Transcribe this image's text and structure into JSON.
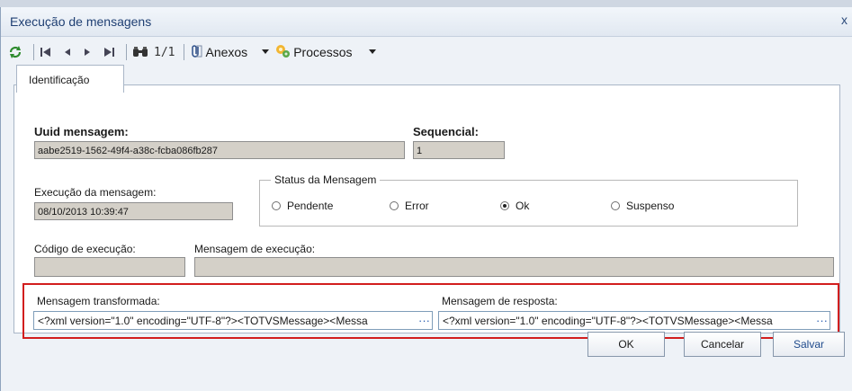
{
  "window": {
    "title": "Execução de mensagens",
    "close_glyph": "x"
  },
  "toolbar": {
    "pager": "1/1",
    "attachments_label": "Anexos",
    "processes_label": "Processos"
  },
  "tabs": [
    {
      "label": "Identificação"
    }
  ],
  "form": {
    "uuid_label": "Uuid mensagem:",
    "uuid_value": "aabe2519-1562-49f4-a38c-fcba086fb287",
    "seq_label": "Sequencial:",
    "seq_value": "1",
    "exec_label": "Execução da mensagem:",
    "exec_value": "08/10/2013 10:39:47",
    "status_legend": "Status da Mensagem",
    "status_options": [
      {
        "label": "Pendente",
        "selected": false
      },
      {
        "label": "Error",
        "selected": false
      },
      {
        "label": "Ok",
        "selected": true
      },
      {
        "label": "Suspenso",
        "selected": false
      }
    ],
    "code_label": "Código de execução:",
    "code_value": "",
    "msg_label": "Mensagem de execução:",
    "msg_value": "",
    "transformed_label": "Mensagem transformada:",
    "transformed_value": "<?xml version=\"1.0\" encoding=\"UTF-8\"?><TOTVSMessage><Messa",
    "response_label": "Mensagem de resposta:",
    "response_value": "<?xml version=\"1.0\" encoding=\"UTF-8\"?><TOTVSMessage><Messa",
    "ellipsis": "···"
  },
  "buttons": {
    "ok": "OK",
    "cancel": "Cancelar",
    "save": "Salvar"
  },
  "colors": {
    "highlight": "#d21e1e",
    "title_text": "#1f3f73"
  }
}
